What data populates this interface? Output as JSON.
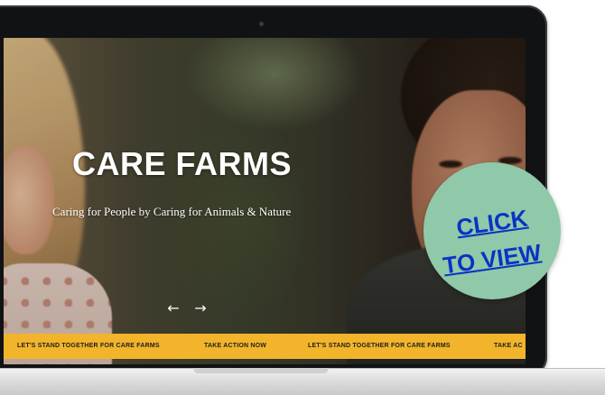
{
  "hero": {
    "title": "CARE FARMS",
    "subtitle": "Caring for People by Caring for Animals & Nature",
    "prev_arrow": "←",
    "next_arrow": "→"
  },
  "ticker": {
    "items": [
      "LET'S STAND TOGETHER FOR CARE FARMS",
      "TAKE ACTION NOW",
      "LET'S STAND TOGETHER FOR CARE FARMS",
      "TAKE AC"
    ]
  },
  "badge": {
    "line1": "CLICK",
    "line2": "TO VIEW"
  },
  "colors": {
    "ticker_bg": "#f2b42b",
    "badge_bg": "#8fc9a9",
    "badge_text": "#0a33c4",
    "laptop_frame": "#111214"
  },
  "icons": {
    "prev": "arrow-left-icon",
    "next": "arrow-right-icon"
  }
}
